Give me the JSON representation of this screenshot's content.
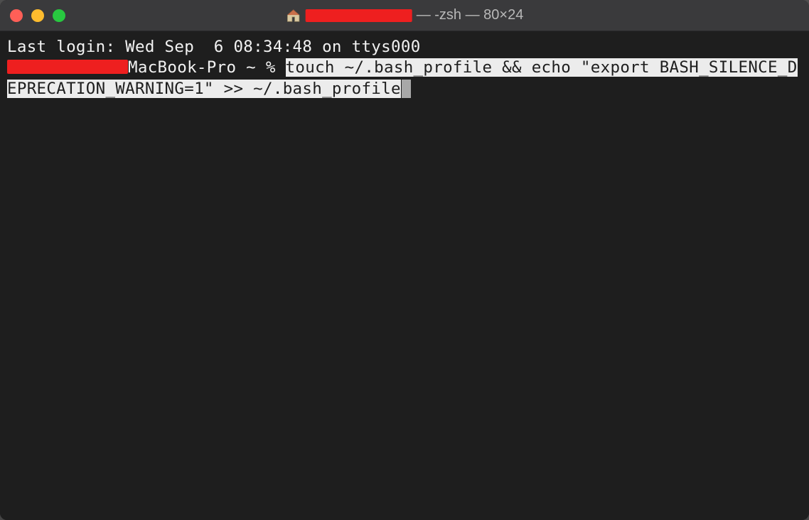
{
  "window": {
    "title_suffix": " — -zsh — 80×24"
  },
  "terminal": {
    "last_login": "Last login: Wed Sep  6 08:34:48 on ttys000",
    "prompt_host": "MacBook-Pro ~ % ",
    "command": "touch ~/.bash_profile && echo \"export BASH_SILENCE_DEPRECATION_WARNING=1\" >> ~/.bash_profile"
  },
  "colors": {
    "close": "#ff5f57",
    "minimize": "#febc2e",
    "zoom": "#28c840",
    "redaction": "#ee1f1f",
    "bg": "#1e1e1e",
    "highlight_bg": "#ececec"
  }
}
